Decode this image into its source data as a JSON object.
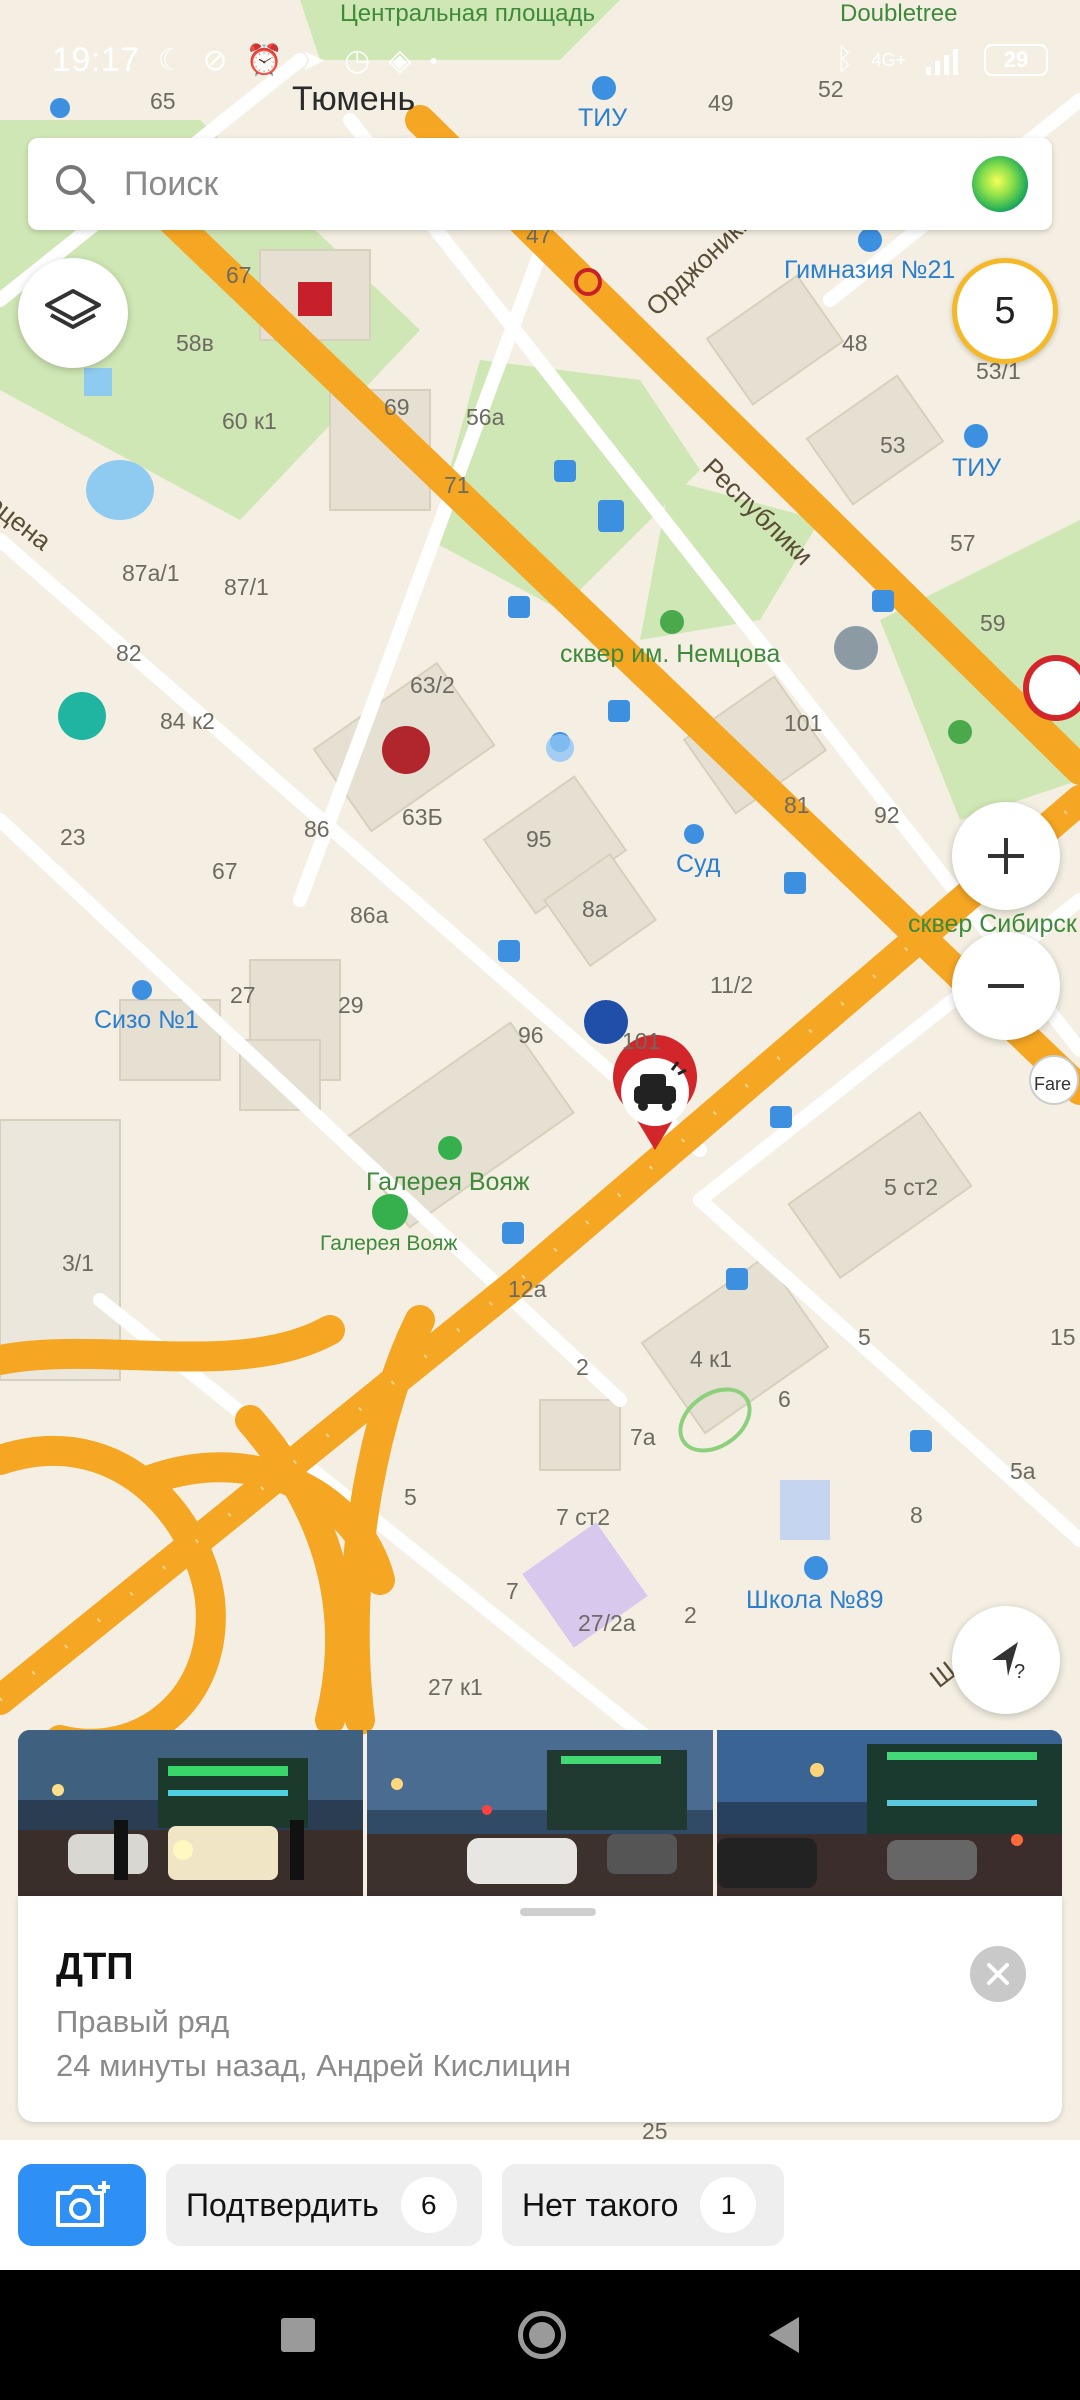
{
  "status_bar": {
    "time": "19:17",
    "network": "4G+",
    "battery": "29"
  },
  "search": {
    "placeholder": "Поиск"
  },
  "map": {
    "cluster_count": "5",
    "labels": {
      "city": "Тюмень",
      "central_square": "Центральная площадь",
      "doubletree": "Doubletree",
      "tiu_top": "ТИУ",
      "gymnasium": "Гимназия №21",
      "tiu_right": "ТИУ",
      "street_ordzh": "Орджоникид",
      "street_respubliki": "Республики",
      "street_left": "оцена",
      "square_nemtsov": "сквер им. Немцова",
      "court": "Суд",
      "square_sibir": "сквер Сибирск",
      "sizo": "Сизо №1",
      "gallery_1": "Галерея Вояж",
      "gallery_2": "Галерея Вояж",
      "school": "Школа №89",
      "fare": "Fare",
      "street_sh": "Ш"
    },
    "house_numbers": [
      "65",
      "49",
      "52",
      "47",
      "67",
      "58в",
      "60 к1",
      "69",
      "56а",
      "71",
      "48",
      "53/1",
      "53",
      "57",
      "59",
      "87а/1",
      "87/1",
      "82",
      "84 к2",
      "63/2",
      "63Б",
      "101",
      "81",
      "92",
      "23",
      "86",
      "67",
      "95",
      "86а",
      "8а",
      "27",
      "29",
      "96",
      "101",
      "11/2",
      "5 ст2",
      "3/1",
      "12а",
      "4 к1",
      "2",
      "6",
      "7а",
      "5",
      "15",
      "5а",
      "5",
      "7 ст2",
      "8",
      "7",
      "27/2а",
      "2",
      "27 к1",
      "25"
    ]
  },
  "incident_card": {
    "title": "ДТП",
    "subtitle": "Правый ряд",
    "meta": "24 минуты назад, Андрей Кислицин"
  },
  "actions": {
    "confirm_label": "Подтвердить",
    "confirm_count": "6",
    "deny_label": "Нет такого",
    "deny_count": "1"
  },
  "colors": {
    "accent": "#2e8ff4",
    "road_major": "#f5a623",
    "park": "#cfe7b4",
    "incident_red": "#d3262b",
    "cluster_ring": "#f5b829"
  }
}
